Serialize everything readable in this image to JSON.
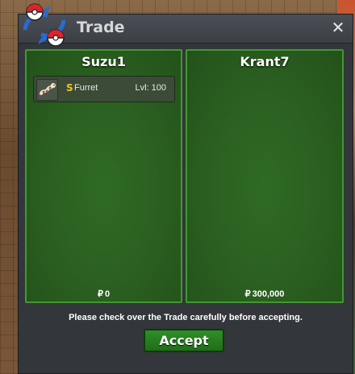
{
  "window": {
    "title": "Trade",
    "close_label": "✕"
  },
  "left_panel": {
    "player_name": "Suzu1",
    "pokemon": [
      {
        "shiny_mark": "S",
        "name": "Furret",
        "level": "Lvl: 100",
        "icon": "furret-sprite-icon"
      }
    ],
    "currency_symbol": "₽",
    "money": "0"
  },
  "right_panel": {
    "player_name": "Krant7",
    "currency_symbol": "₽",
    "money": "300,000"
  },
  "notice": "Please check over the Trade carefully before accepting.",
  "accept_label": "Accept",
  "colors": {
    "panel_green": "#2f6b25",
    "panel_border": "#3f9a2e",
    "accept_green": "#2f8f26",
    "shiny_gold": "#f3c325"
  }
}
